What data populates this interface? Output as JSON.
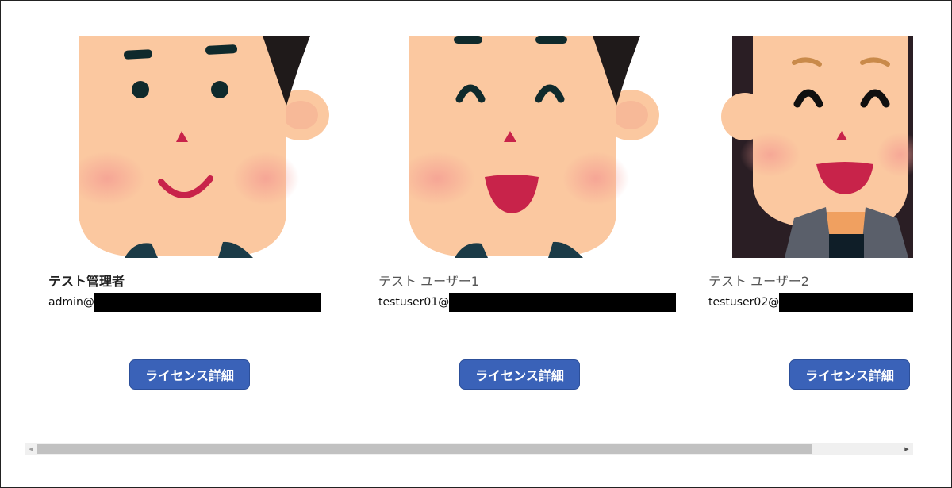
{
  "users": [
    {
      "name": "テスト管理者",
      "email_prefix": "admin@",
      "button_label": "ライセンス詳細",
      "avatar_icon": "smiling-man-avatar-icon"
    },
    {
      "name": "テスト ユーザー1",
      "email_prefix": "testuser01@",
      "button_label": "ライセンス詳細",
      "avatar_icon": "laughing-man-avatar-icon"
    },
    {
      "name": "テスト ユーザー2",
      "email_prefix": "testuser02@",
      "button_label": "ライセンス詳細",
      "avatar_icon": "laughing-woman-avatar-icon"
    }
  ],
  "scrollbar": {
    "left_arrow": "◀",
    "right_arrow": "▶",
    "position_fraction": 0.88
  },
  "colors": {
    "button": "#3a62b8",
    "skin": "#fbc8a0",
    "cheek": "#f49a92",
    "hair": "#1f1a1a",
    "mouth": "#c8234a",
    "redaction": "#000000"
  }
}
